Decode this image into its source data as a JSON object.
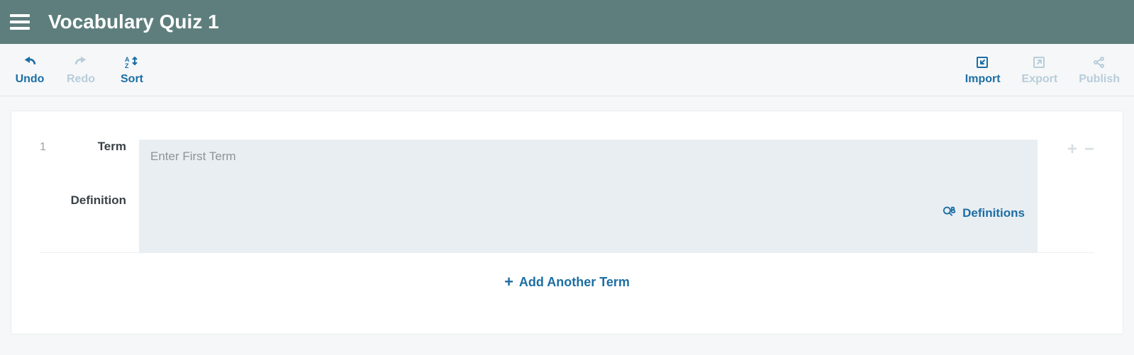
{
  "header": {
    "title": "Vocabulary Quiz 1"
  },
  "toolbar": {
    "undo": "Undo",
    "redo": "Redo",
    "sort": "Sort",
    "import": "Import",
    "export": "Export",
    "publish": "Publish"
  },
  "termCard": {
    "index": "1",
    "termLabel": "Term",
    "definitionLabel": "Definition",
    "termPlaceholder": "Enter First Term",
    "definitionsLink": "Definitions",
    "addAnother": "Add Another Term"
  }
}
